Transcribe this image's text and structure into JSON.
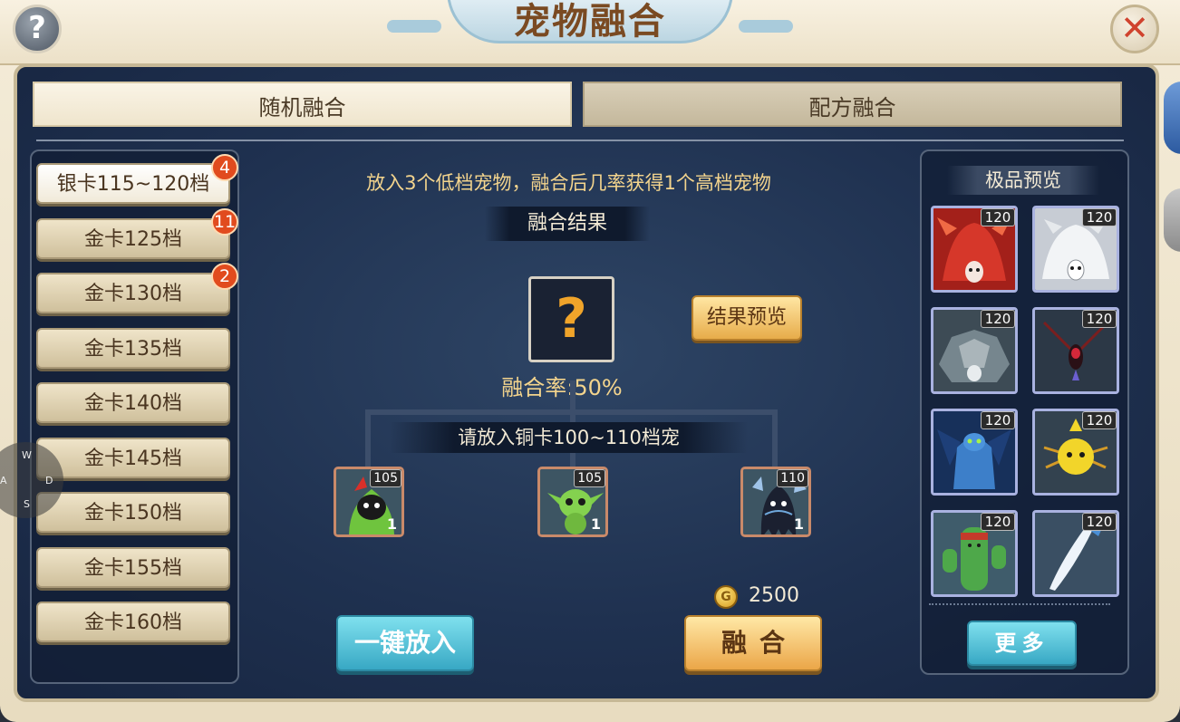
{
  "header": {
    "title": "宠物融合",
    "help_glyph": "?",
    "close_glyph": "✕"
  },
  "tabs": [
    {
      "label": "随机融合",
      "active": true
    },
    {
      "label": "配方融合",
      "active": false
    }
  ],
  "grades": [
    {
      "label": "银卡115~120档",
      "badge": "4",
      "selected": true
    },
    {
      "label": "金卡125档",
      "badge": "11"
    },
    {
      "label": "金卡130档",
      "badge": "2"
    },
    {
      "label": "金卡135档"
    },
    {
      "label": "金卡140档"
    },
    {
      "label": "金卡145档"
    },
    {
      "label": "金卡150档"
    },
    {
      "label": "金卡155档"
    },
    {
      "label": "金卡160档"
    }
  ],
  "fusion": {
    "description": "放入3个低档宠物，融合后几率获得1个高档宠物",
    "result_label": "融合结果",
    "result_placeholder": "?",
    "preview_button": "结果预览",
    "rate": "融合率:50%",
    "slot_hint": "请放入铜卡100~110档宠",
    "slots": [
      {
        "level": "105",
        "count": "1",
        "pet": "green-hooded-sprite"
      },
      {
        "level": "105",
        "count": "1",
        "pet": "green-goblin"
      },
      {
        "level": "110",
        "count": "1",
        "pet": "dark-ghost"
      }
    ],
    "cost": "2500",
    "coin_glyph": "G",
    "one_click_button": "一键放入",
    "fuse_button": "融合"
  },
  "premium_preview": {
    "title": "极品预览",
    "pets": [
      {
        "level": "120",
        "pet": "red-demon",
        "color": "#c0281c"
      },
      {
        "level": "120",
        "pet": "white-beast",
        "color": "#d8dde4"
      },
      {
        "level": "120",
        "pet": "stone-golem",
        "color": "#5a6b72"
      },
      {
        "level": "120",
        "pet": "red-insect",
        "color": "#34404f"
      },
      {
        "level": "120",
        "pet": "blue-demon",
        "color": "#1d4d8a"
      },
      {
        "level": "120",
        "pet": "yellow-spider",
        "color": "#3a4a5b"
      },
      {
        "level": "120",
        "pet": "cactus",
        "color": "#2f8a4a"
      },
      {
        "level": "120",
        "pet": "ice-blade",
        "color": "#41566b"
      }
    ],
    "more_button": "更多"
  },
  "joystick": {
    "up": "W",
    "left": "A",
    "right": "D",
    "down": "S"
  }
}
